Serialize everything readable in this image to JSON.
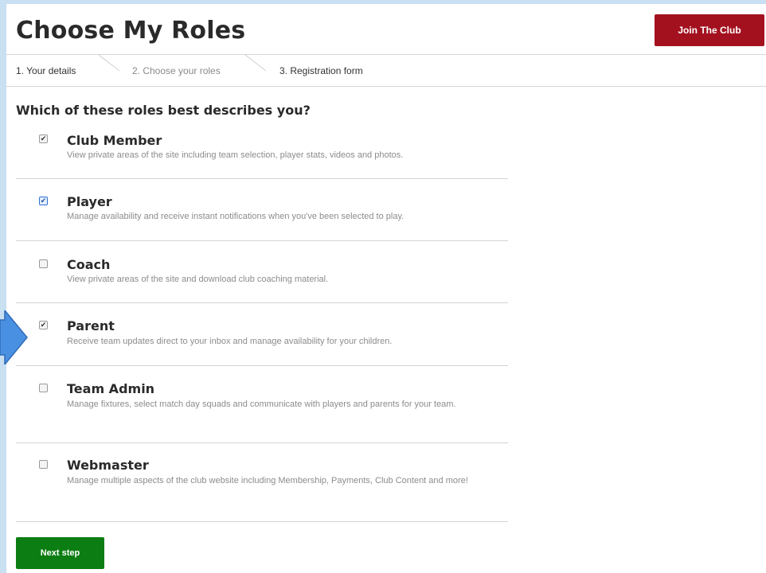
{
  "header": {
    "title": "Choose My Roles",
    "join_label": "Join The Club"
  },
  "steps": [
    {
      "label": "1. Your details",
      "state": "done"
    },
    {
      "label": "2. Choose your roles",
      "state": "current"
    },
    {
      "label": "3. Registration form",
      "state": "upcoming"
    }
  ],
  "question": "Which of these roles best describes you?",
  "roles": [
    {
      "title": "Club Member",
      "desc": "View private areas of the site including team selection, player stats, videos and photos.",
      "checked": true
    },
    {
      "title": "Player",
      "desc": "Manage availability and receive instant notifications when you've been selected to play.",
      "checked": true
    },
    {
      "title": "Coach",
      "desc": "View private areas of the site and download club coaching material.",
      "checked": false
    },
    {
      "title": "Parent",
      "desc": "Receive team updates direct to your inbox and manage availability for your children.",
      "checked": true
    },
    {
      "title": "Team Admin",
      "desc": "Manage fixtures, select match day squads and communicate with players and parents for your team.",
      "checked": false
    },
    {
      "title": "Webmaster",
      "desc": "Manage multiple aspects of the club website including Membership, Payments, Club Content and more!",
      "checked": false
    }
  ],
  "next_label": "Next step",
  "colors": {
    "join_button": "#a3111f",
    "next_button": "#0c7d13",
    "pointer_arrow": "#4a90e2",
    "background": "#c9dff2"
  },
  "icons": {
    "pointer": "right-arrow-icon",
    "checkbox": "checkbox-icon"
  }
}
